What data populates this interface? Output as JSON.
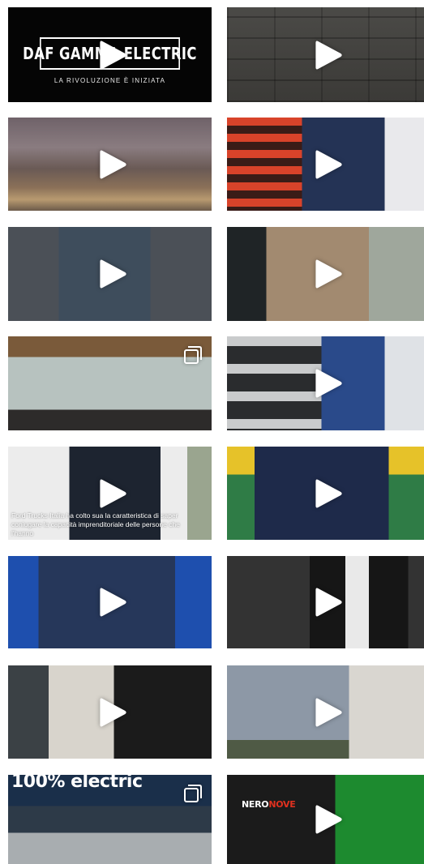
{
  "colors": {
    "icon": "#ffffff",
    "background": "#ffffff"
  },
  "icons": {
    "video": "play-icon",
    "carousel": "multiple-images-icon"
  },
  "tiles": [
    {
      "kind": "video",
      "logo_title": "DAF GAMMA ELECTRIC",
      "logo_tagline": "LA RIVOLUZIONE È INIZIATA"
    },
    {
      "kind": "video"
    },
    {
      "kind": "video"
    },
    {
      "kind": "video"
    },
    {
      "kind": "video"
    },
    {
      "kind": "video"
    },
    {
      "kind": "carousel"
    },
    {
      "kind": "video"
    },
    {
      "kind": "video",
      "caption": "Ford Trucks Italia ha colto sua la caratteristica di saper coniugare la capacità imprenditoriale delle persone che l'hanno"
    },
    {
      "kind": "video"
    },
    {
      "kind": "video"
    },
    {
      "kind": "video"
    },
    {
      "kind": "video"
    },
    {
      "kind": "video"
    },
    {
      "kind": "carousel",
      "sign_text": "100% electric"
    },
    {
      "kind": "video",
      "shirt_word_1": "NERO",
      "shirt_word_2": "NOVE"
    }
  ]
}
